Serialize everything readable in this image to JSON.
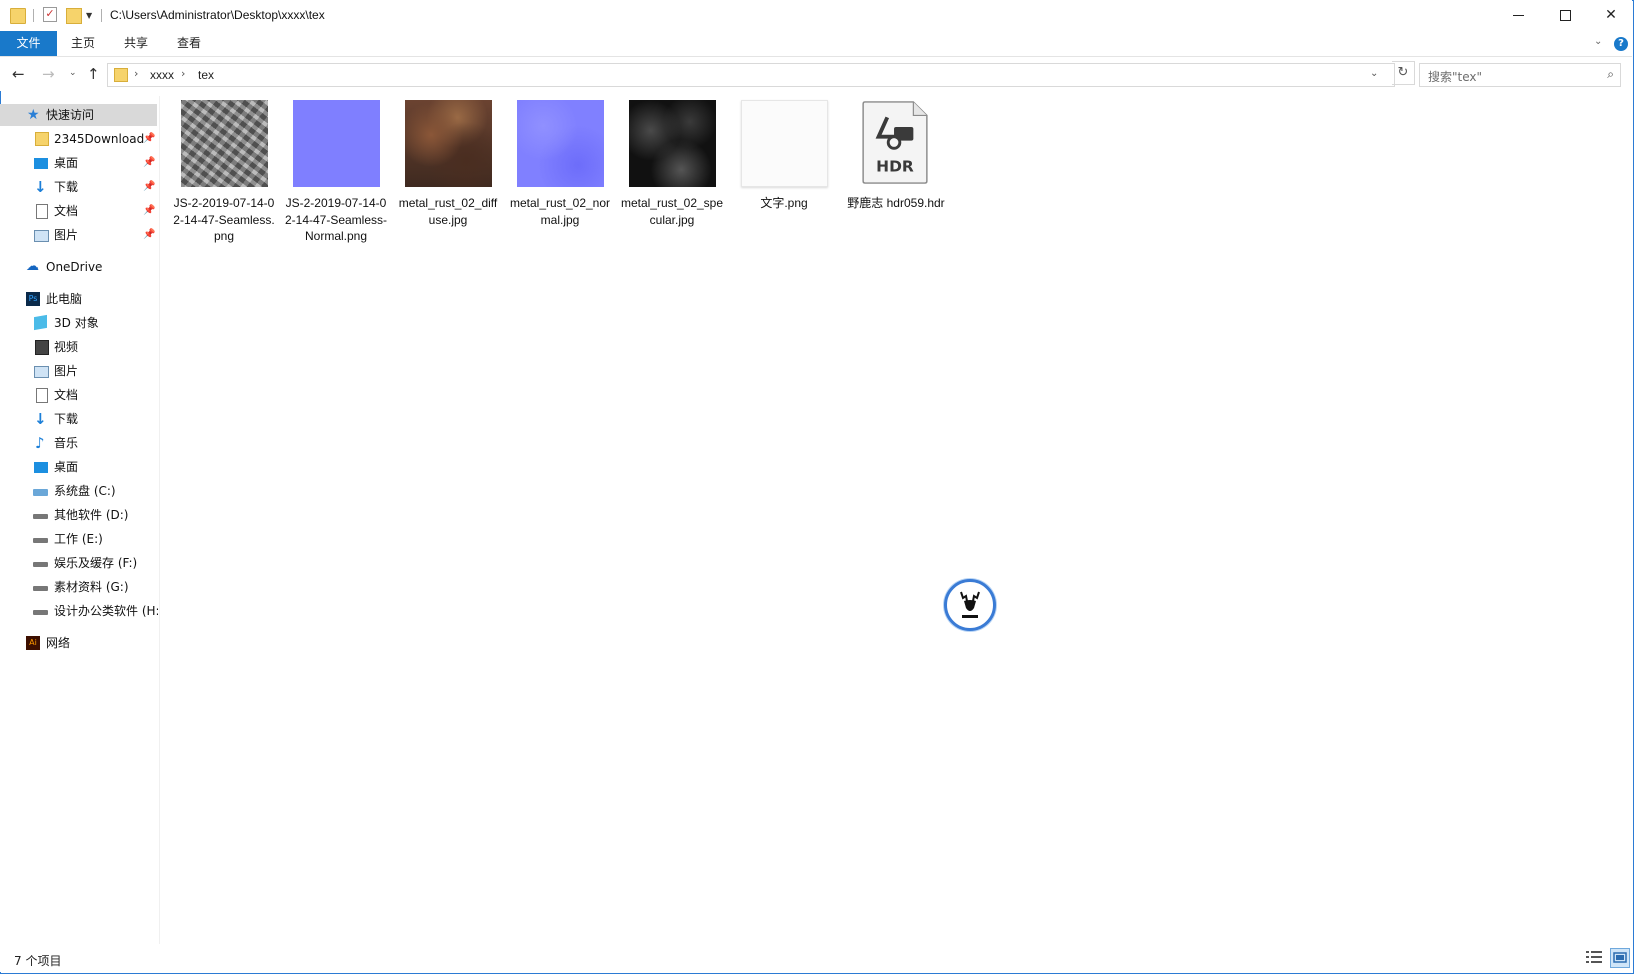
{
  "window": {
    "title_path": "C:\\Users\\Administrator\\Desktop\\xxxx\\tex",
    "controls": [
      "minimize",
      "maximize",
      "close"
    ]
  },
  "ribbon": {
    "tabs": [
      "文件",
      "主页",
      "共享",
      "查看"
    ]
  },
  "address": {
    "crumbs": [
      "xxxx",
      "tex"
    ]
  },
  "search": {
    "placeholder": "搜索\"tex\""
  },
  "sidebar": {
    "quick_access": "快速访问",
    "quick_items": [
      "2345Download",
      "桌面",
      "下载",
      "文档",
      "图片"
    ],
    "onedrive": "OneDrive",
    "this_pc": "此电脑",
    "pc_items": [
      "3D 对象",
      "视频",
      "图片",
      "文档",
      "下载",
      "音乐",
      "桌面",
      "系统盘 (C:)",
      "其他软件 (D:)",
      "工作 (E:)",
      "娱乐及缓存 (F:)",
      "素材资料 (G:)",
      "设计办公类软件 (H:"
    ],
    "network": "网络"
  },
  "files": [
    {
      "name": "JS-2-2019-07-14-02-14-47-Seamless.png",
      "icon": "image-thumbnail"
    },
    {
      "name": "JS-2-2019-07-14-02-14-47-Seamless-Normal.png",
      "icon": "image-thumbnail"
    },
    {
      "name": "metal_rust_02_diffuse.jpg",
      "icon": "image-thumbnail"
    },
    {
      "name": "metal_rust_02_normal.jpg",
      "icon": "image-thumbnail"
    },
    {
      "name": "metal_rust_02_specular.jpg",
      "icon": "image-thumbnail"
    },
    {
      "name": "文字.png",
      "icon": "image-thumbnail"
    },
    {
      "name": "野鹿志 hdr059.hdr",
      "icon": "hdr-file-icon",
      "badge": "HDR"
    }
  ],
  "status": {
    "item_count": "7 个项目"
  },
  "colors": {
    "accent": "#1979ca",
    "selection": "#d9d9d9",
    "normal_map": "#7f7fff"
  }
}
